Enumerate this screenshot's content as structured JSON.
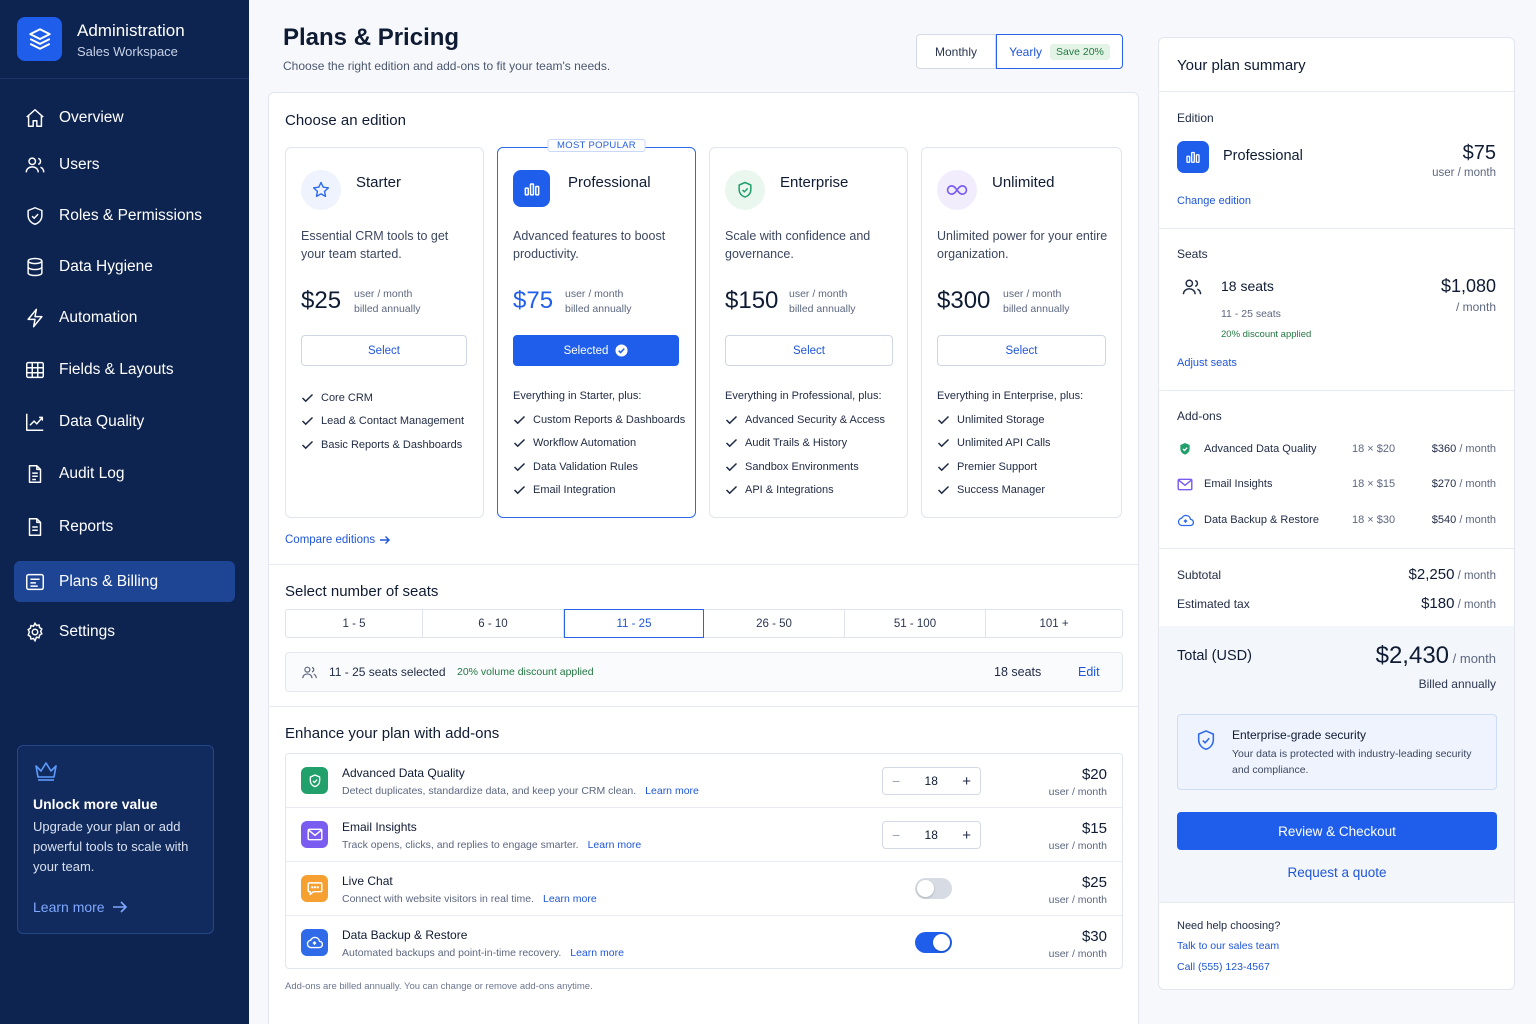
{
  "brand": {
    "title": "Administration",
    "subtitle": "Sales Workspace"
  },
  "nav": [
    {
      "label": "Overview",
      "icon": "home-icon"
    },
    {
      "label": "Users",
      "icon": "users-icon"
    },
    {
      "label": "Roles & Permissions",
      "icon": "shield-icon"
    },
    {
      "label": "Data Hygiene",
      "icon": "database-icon"
    },
    {
      "label": "Automation",
      "icon": "lightning-icon"
    },
    {
      "label": "Fields & Layouts",
      "icon": "table-icon"
    },
    {
      "label": "Data Quality",
      "icon": "trend-chart-icon"
    },
    {
      "label": "Audit Log",
      "icon": "document-icon"
    },
    {
      "label": "Reports",
      "icon": "report-icon"
    },
    {
      "label": "Plans & Billing",
      "icon": "billing-icon",
      "active": true
    },
    {
      "label": "Settings",
      "icon": "gear-icon"
    }
  ],
  "promo": {
    "title": "Unlock more value",
    "text": "Upgrade your plan or add powerful tools to scale with your team.",
    "link": "Learn more"
  },
  "header": {
    "title": "Plans & Pricing",
    "subtitle": "Choose the right edition and add-ons to fit your team's needs.",
    "billing_toggle": {
      "monthly": "Monthly",
      "yearly": "Yearly",
      "save": "Save 20%",
      "selected": "Yearly"
    }
  },
  "editions": {
    "section_title": "Choose an edition",
    "popular_badge": "MOST POPULAR",
    "price_unit": "user / month",
    "price_billing": "billed annually",
    "items": [
      {
        "name": "Starter",
        "icon": "star-icon",
        "desc": "Essential CRM tools to get your team started.",
        "price": "$25",
        "button": "Select",
        "feature_head": "",
        "features": [
          "Core CRM",
          "Lead & Contact Management",
          "Basic Reports & Dashboards"
        ]
      },
      {
        "name": "Professional",
        "icon": "bar-chart-icon",
        "desc": "Advanced features to boost productivity.",
        "price": "$75",
        "button": "Selected",
        "selected": true,
        "feature_head": "Everything in Starter, plus:",
        "features": [
          "Custom Reports & Dashboards",
          "Workflow Automation",
          "Data Validation Rules",
          "Email Integration"
        ]
      },
      {
        "name": "Enterprise",
        "icon": "shield-check-icon",
        "desc": "Scale with confidence and governance.",
        "price": "$150",
        "button": "Select",
        "feature_head": "Everything in Professional, plus:",
        "features": [
          "Advanced Security & Access",
          "Audit Trails & History",
          "Sandbox Environments",
          "API & Integrations"
        ]
      },
      {
        "name": "Unlimited",
        "icon": "infinity-icon",
        "desc": "Unlimited power for your entire organization.",
        "price": "$300",
        "button": "Select",
        "feature_head": "Everything in Enterprise, plus:",
        "features": [
          "Unlimited Storage",
          "Unlimited API Calls",
          "Premier Support",
          "Success Manager"
        ]
      }
    ],
    "compare_link": "Compare editions"
  },
  "seats": {
    "section_title": "Select number of seats",
    "tiers": [
      "1 - 5",
      "6 - 10",
      "11 - 25",
      "26 - 50",
      "51 - 100",
      "101 +"
    ],
    "selected_tier": "11 - 25",
    "bar_text": "11 - 25 seats selected",
    "discount_text": "20% volume discount applied",
    "count": "18 seats",
    "edit": "Edit"
  },
  "addons": {
    "section_title": "Enhance your plan with add-ons",
    "learn_more": "Learn more",
    "unit": "user / month",
    "items": [
      {
        "name": "Advanced Data Quality",
        "desc": "Detect duplicates, standardize data, and keep your CRM clean.",
        "price": "$20",
        "control": "stepper",
        "qty": "18",
        "icon": "shield-check-icon",
        "color": "#22a06b"
      },
      {
        "name": "Email Insights",
        "desc": "Track opens, clicks, and replies to engage smarter.",
        "price": "$15",
        "control": "stepper",
        "qty": "18",
        "icon": "mail-icon",
        "color": "#7b5cf0"
      },
      {
        "name": "Live Chat",
        "desc": "Connect with website visitors in real time.",
        "price": "$25",
        "control": "switch",
        "enabled": false,
        "icon": "chat-icon",
        "color": "#f5a031"
      },
      {
        "name": "Data Backup & Restore",
        "desc": "Automated backups and point-in-time recovery.",
        "price": "$30",
        "control": "switch",
        "enabled": true,
        "icon": "cloud-icon",
        "color": "#2f6ae9"
      }
    ],
    "note": "Add-ons are billed annually. You can change or remove add-ons anytime."
  },
  "summary": {
    "title": "Your plan summary",
    "edition_label": "Edition",
    "edition_name": "Professional",
    "edition_price": "$75",
    "edition_unit": "user / month",
    "change_edition": "Change edition",
    "seats_label": "Seats",
    "seats_count": "18 seats",
    "seats_range": "11 - 25 seats",
    "seats_discount": "20% discount applied",
    "seats_price": "$1,080",
    "seats_unit": "/ month",
    "adjust_seats": "Adjust seats",
    "addons_label": "Add-ons",
    "addons": [
      {
        "name": "Advanced Data Quality",
        "qty": "18 × $20",
        "amount": "$360",
        "unit": "/ month",
        "icon": "shield-check-icon"
      },
      {
        "name": "Email Insights",
        "qty": "18 × $15",
        "amount": "$270",
        "unit": "/ month",
        "icon": "mail-icon"
      },
      {
        "name": "Data Backup & Restore",
        "qty": "18 × $30",
        "amount": "$540",
        "unit": "/ month",
        "icon": "cloud-icon"
      }
    ],
    "subtotal_label": "Subtotal",
    "subtotal": "$2,250",
    "tax_label": "Estimated tax",
    "tax": "$180",
    "per_month": "/ month",
    "total_label": "Total (USD)",
    "total": "$2,430",
    "total_unit": "/ month",
    "billed": "Billed annually",
    "security_title": "Enterprise-grade security",
    "security_text": "Your data is protected with industry-leading security and compliance.",
    "checkout": "Review & Checkout",
    "quote": "Request a quote",
    "help_title": "Need help choosing?",
    "help_link1": "Talk to our sales team",
    "help_link2": "Call (555) 123-4567"
  },
  "colors": {
    "sidebar": "#0d2350",
    "accent": "#1e5eea",
    "success": "#237842"
  }
}
